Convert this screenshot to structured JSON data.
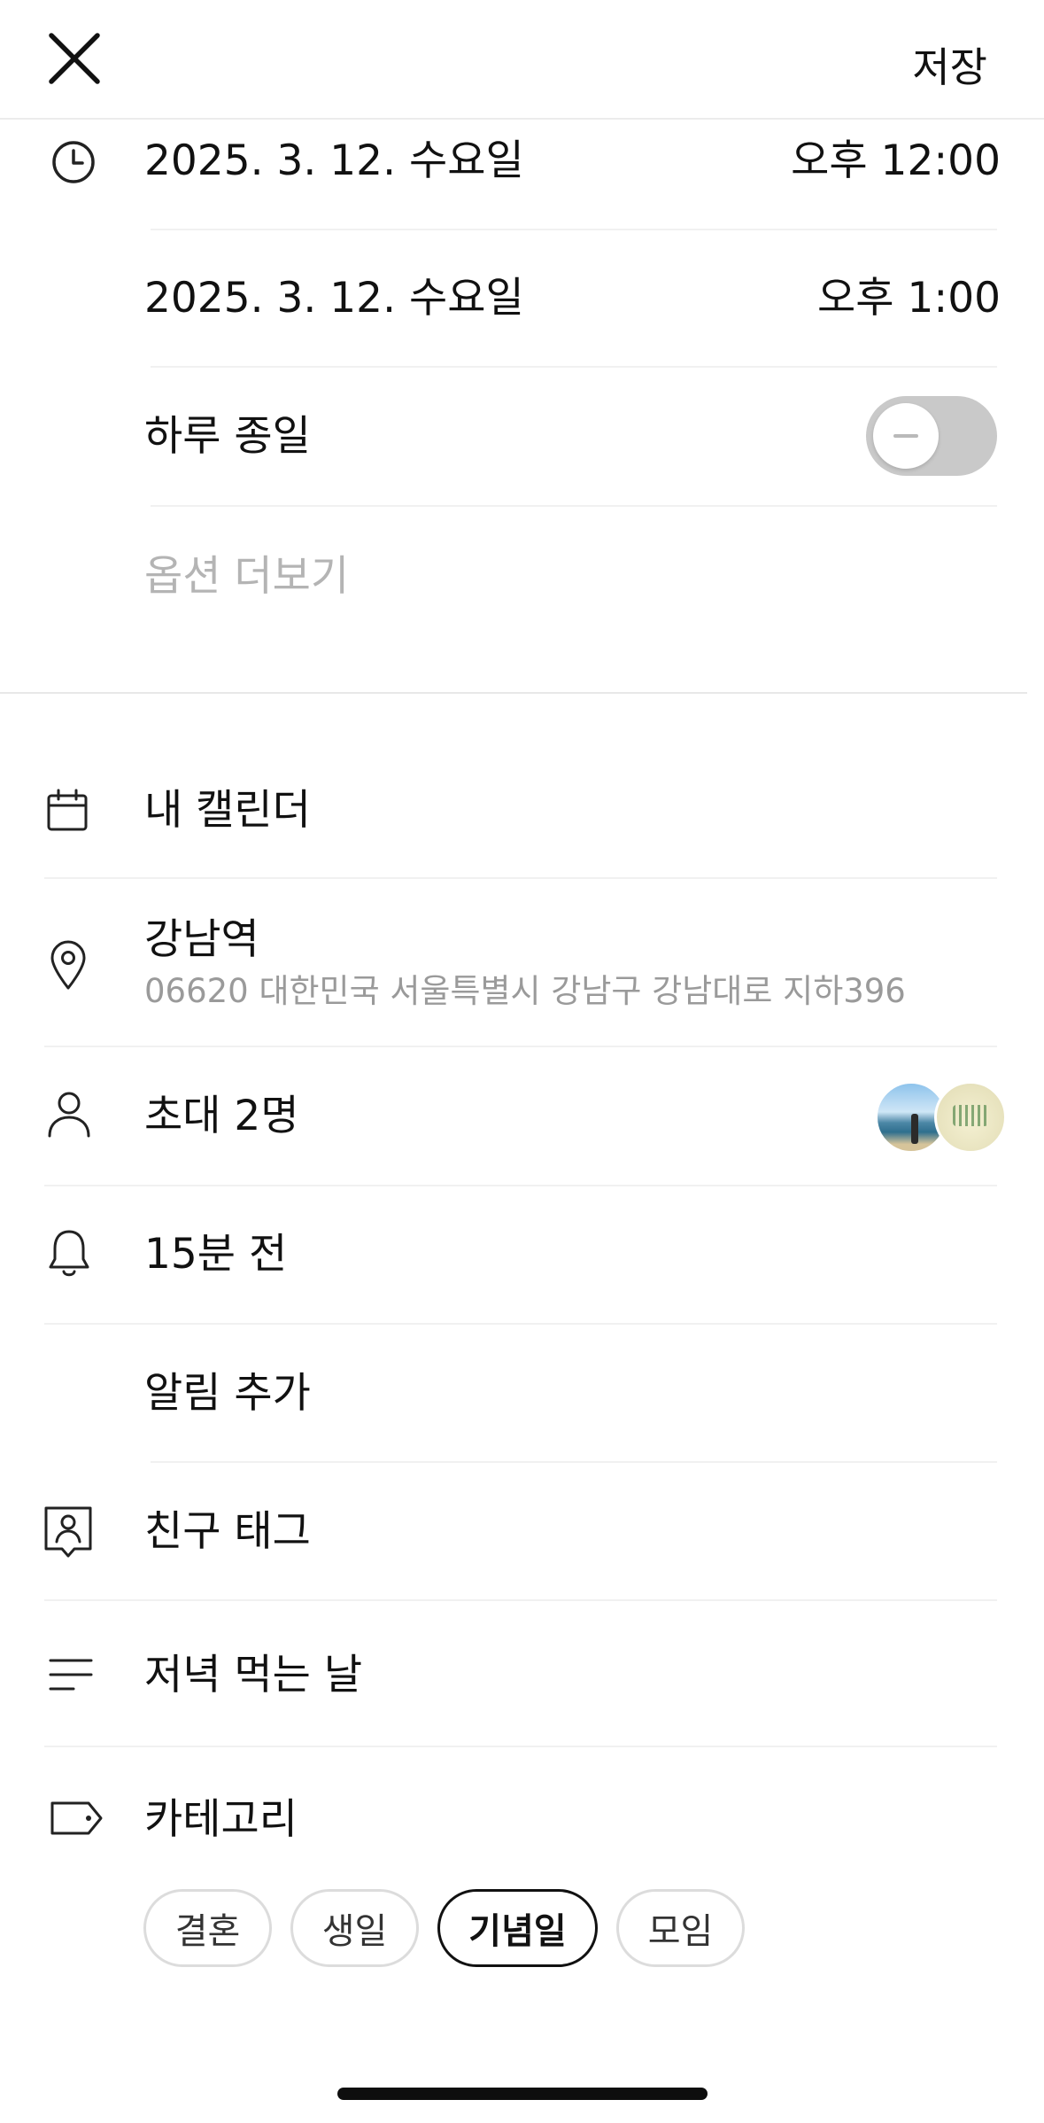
{
  "header": {
    "save_label": "저장"
  },
  "datetime": {
    "start_date": "2025. 3. 12. 수요일",
    "start_time": "오후 12:00",
    "end_date": "2025. 3. 12. 수요일",
    "end_time": "오후 1:00",
    "all_day_label": "하루 종일",
    "all_day_on": false,
    "more_options": "옵션 더보기"
  },
  "calendar": {
    "label": "내 캘린더"
  },
  "location": {
    "name": "강남역",
    "address": "06620 대한민국 서울특별시 강남구 강남대로 지하396"
  },
  "invite": {
    "label": "초대 2명"
  },
  "alarm": {
    "label": "15분 전",
    "add_label": "알림 추가"
  },
  "friend_tag": {
    "label": "친구 태그"
  },
  "memo": {
    "text": "저녁 먹는 날"
  },
  "category": {
    "label": "카테고리",
    "chips": [
      "결혼",
      "생일",
      "기념일",
      "모임"
    ],
    "selected": "기념일"
  },
  "colors": {
    "accent": "#111111",
    "toggle_off": "#c9c9c9",
    "muted_text": "#9a9a9a"
  }
}
